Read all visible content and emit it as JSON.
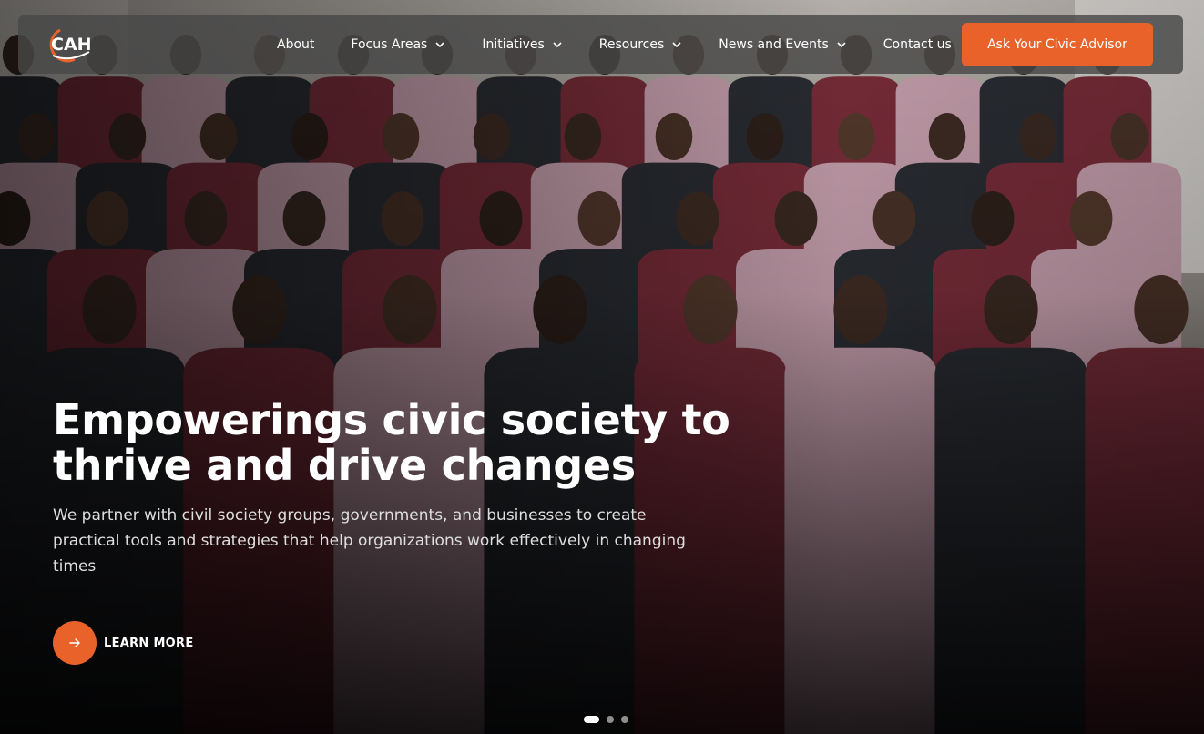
{
  "brand": {
    "logo_text": "CAH",
    "accent_color": "#e8622a"
  },
  "nav": {
    "items": [
      {
        "label": "About",
        "has_dropdown": false
      },
      {
        "label": "Focus Areas",
        "has_dropdown": true
      },
      {
        "label": "Initiatives",
        "has_dropdown": true
      },
      {
        "label": "Resources",
        "has_dropdown": true
      },
      {
        "label": "News and Events",
        "has_dropdown": true
      },
      {
        "label": "Contact us",
        "has_dropdown": false
      }
    ],
    "cta_label": "Ask Your Civic Advisor"
  },
  "hero": {
    "title_line1": "Empowerings civic society to",
    "title_line2": "thrive and drive changes",
    "subtitle": "We partner with civil society groups, governments, and businesses to create practical tools and strategies that help organizations work effectively in changing times",
    "learn_more_label": "LEARN MORE",
    "learn_more_icon": "arrow-right-icon",
    "background": "group-photo-of-conference-attendees"
  },
  "carousel": {
    "slide_count": 3,
    "active_index": 0
  }
}
